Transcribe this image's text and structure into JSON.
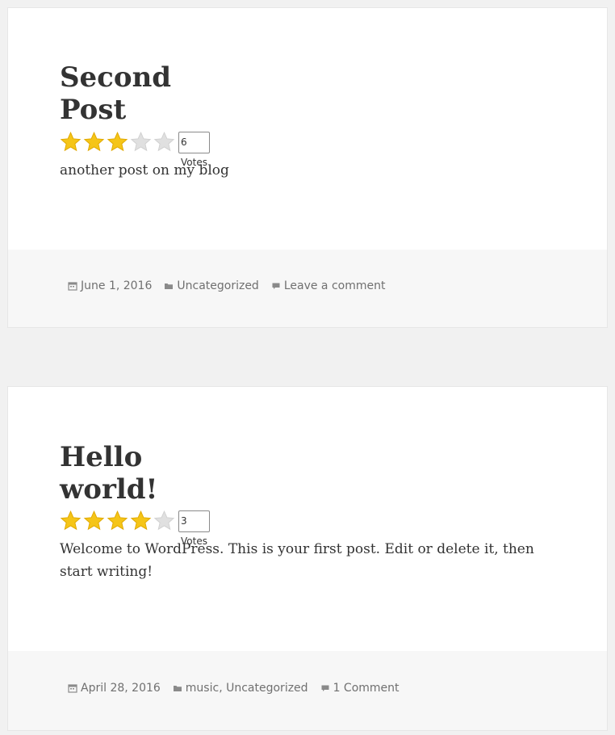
{
  "posts": [
    {
      "title": "Second Post",
      "rating": 3,
      "max_rating": 5,
      "votes_label": "6 Votes",
      "excerpt": "another post on my blog",
      "date": "June 1, 2016",
      "categories": [
        "Uncategorized"
      ],
      "comments_label": "Leave a comment"
    },
    {
      "title": "Hello world!",
      "rating": 4,
      "max_rating": 5,
      "votes_label": "3 Votes",
      "excerpt": "Welcome to WordPress. This is your first post. Edit or delete it, then start writing!",
      "date": "April 28, 2016",
      "categories": [
        "music",
        "Uncategorized"
      ],
      "category_separator": ",",
      "comments_label": "1 Comment"
    }
  ],
  "icons": {
    "date": "calendar-icon",
    "category": "folder-icon",
    "comment": "comment-bubble-icon",
    "star_filled": "star-filled-icon",
    "star_empty": "star-empty-icon"
  },
  "colors": {
    "page_background": "#f1f1f1",
    "card_background": "#ffffff",
    "footer_background": "#f7f7f7",
    "star_filled": "#f5c518",
    "star_empty": "#e0e0e0",
    "meta_text": "#707070",
    "body_text": "#333333"
  }
}
